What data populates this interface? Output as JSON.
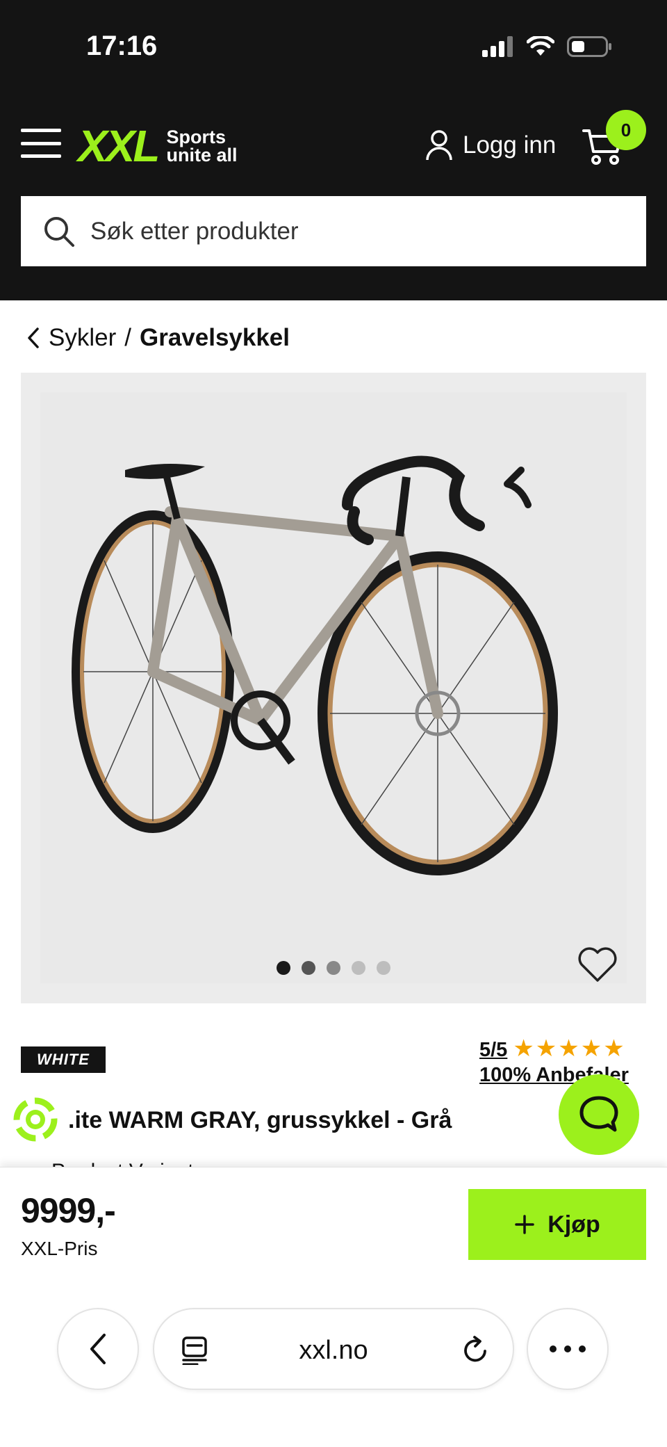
{
  "status_bar": {
    "time": "17:16"
  },
  "header": {
    "logo_mark": "XXL",
    "logo_tagline_1": "Sports",
    "logo_tagline_2": "unite all",
    "login_label": "Logg inn",
    "cart_count": "0"
  },
  "search": {
    "placeholder": "Søk etter produkter"
  },
  "breadcrumb": {
    "parent": "Sykler",
    "separator": "/",
    "current": "Gravelsykkel"
  },
  "gallery": {
    "image_count": 5,
    "active_index": 0
  },
  "product": {
    "brand": "WHITE",
    "rating": "5/5",
    "recommend": "100% Anbefaler",
    "title": ".ite WARM GRAY, grussykkel - Grå",
    "partial_line": "Product Variant"
  },
  "buy_bar": {
    "price": "9999,-",
    "price_label": "XXL-Pris",
    "buy_label": "Kjøp"
  },
  "browser": {
    "url": "xxl.no"
  },
  "colors": {
    "brand_green": "#9cf01c",
    "header_bg": "#141414",
    "star": "#f5a300"
  }
}
